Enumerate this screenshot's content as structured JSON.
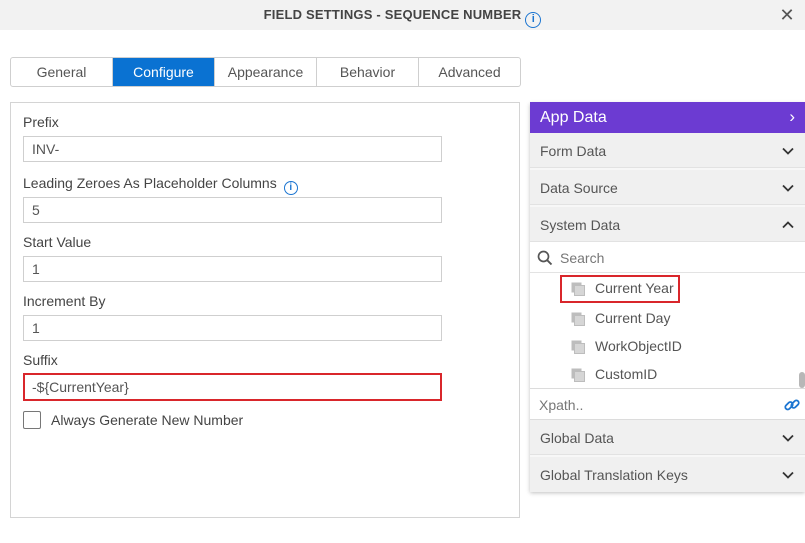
{
  "dialog": {
    "title": "FIELD SETTINGS - SEQUENCE NUMBER",
    "info_icon": "info-icon",
    "close_icon": "close-icon",
    "close_glyph": "✕"
  },
  "tabs": [
    {
      "label": "General",
      "active": false
    },
    {
      "label": "Configure",
      "active": true
    },
    {
      "label": "Appearance",
      "active": false
    },
    {
      "label": "Behavior",
      "active": false
    },
    {
      "label": "Advanced",
      "active": false
    }
  ],
  "form": {
    "prefix": {
      "label": "Prefix",
      "value": "INV-"
    },
    "leading_zeroes": {
      "label": "Leading Zeroes As Placeholder Columns",
      "value": "5"
    },
    "start_value": {
      "label": "Start Value",
      "value": "1"
    },
    "increment_by": {
      "label": "Increment By",
      "value": "1"
    },
    "suffix": {
      "label": "Suffix",
      "value": "-${CurrentYear}"
    },
    "always_generate": {
      "label": "Always Generate New Number",
      "checked": false
    }
  },
  "app_data": {
    "title": "App Data",
    "header_chevron": "›",
    "sections": {
      "form_data": "Form Data",
      "data_source": "Data Source",
      "system_data": "System Data",
      "global_data": "Global Data",
      "global_translation_keys": "Global Translation Keys"
    },
    "search_placeholder": "Search",
    "system_items": [
      "Current Year",
      "Current Day",
      "WorkObjectID",
      "CustomID"
    ],
    "xpath_placeholder": "Xpath.."
  },
  "colors": {
    "accent_blue": "#0a72d2",
    "app_data_purple": "#6c3bd2",
    "highlight_red": "#d9262b"
  }
}
